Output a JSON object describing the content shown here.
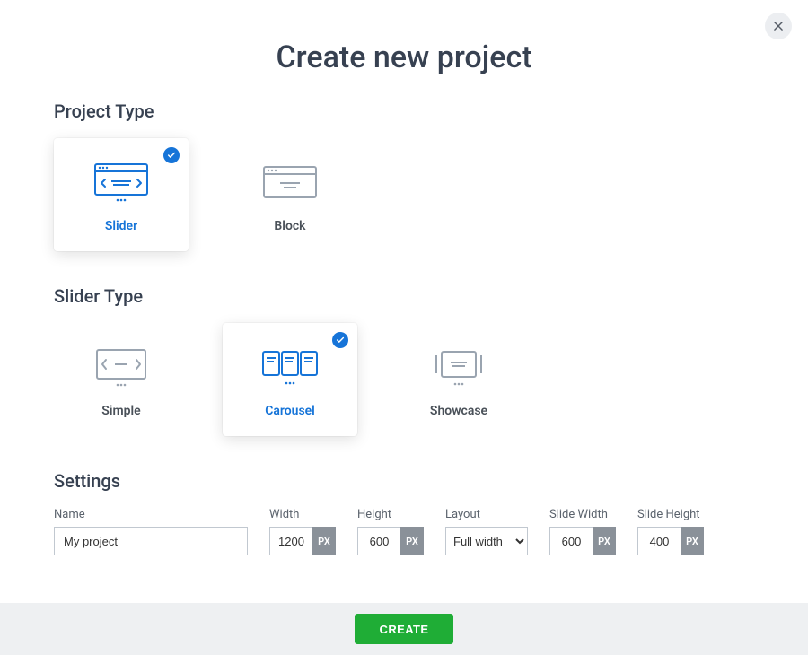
{
  "title": "Create new project",
  "projectType": {
    "heading": "Project Type",
    "options": [
      {
        "label": "Slider"
      },
      {
        "label": "Block"
      }
    ]
  },
  "sliderType": {
    "heading": "Slider Type",
    "options": [
      {
        "label": "Simple"
      },
      {
        "label": "Carousel"
      },
      {
        "label": "Showcase"
      }
    ]
  },
  "settings": {
    "heading": "Settings",
    "name": {
      "label": "Name",
      "value": "My project"
    },
    "width": {
      "label": "Width",
      "value": "1200",
      "unit": "PX"
    },
    "height": {
      "label": "Height",
      "value": "600",
      "unit": "PX"
    },
    "layout": {
      "label": "Layout",
      "value": "Full width"
    },
    "slideWidth": {
      "label": "Slide Width",
      "value": "600",
      "unit": "PX"
    },
    "slideHeight": {
      "label": "Slide Height",
      "value": "400",
      "unit": "PX"
    }
  },
  "buttons": {
    "create": "CREATE"
  }
}
